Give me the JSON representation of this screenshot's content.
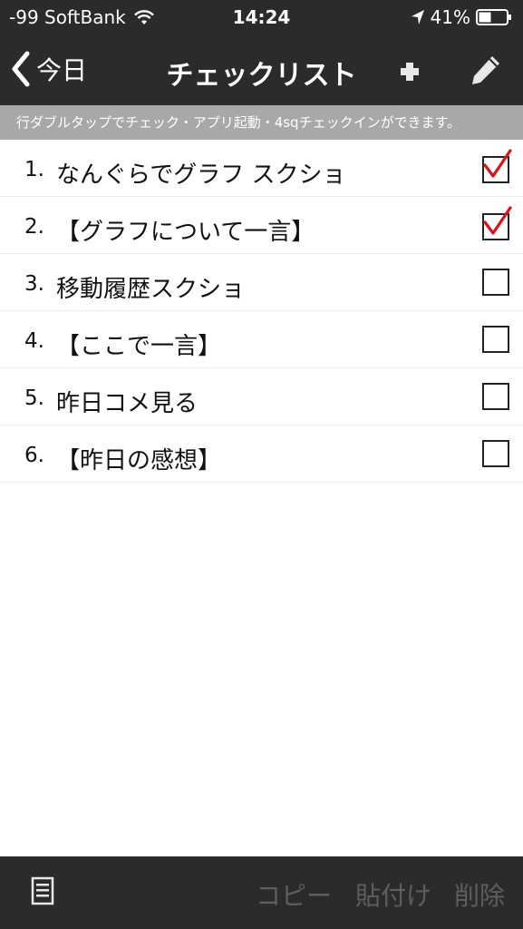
{
  "status": {
    "carrier": "-99 SoftBank",
    "time": "14:24",
    "battery": "41%"
  },
  "nav": {
    "back_label": "今日",
    "title": "チェックリスト"
  },
  "hint": "行ダブルタップでチェック・アプリ起動・4sqチェックインができます。",
  "items": [
    {
      "num": "1.",
      "text": "なんぐらでグラフ スクショ",
      "checked": true
    },
    {
      "num": "2.",
      "text": "【グラフについて一言】",
      "checked": true
    },
    {
      "num": "3.",
      "text": "移動履歴スクショ",
      "checked": false
    },
    {
      "num": "4.",
      "text": "【ここで一言】",
      "checked": false
    },
    {
      "num": "5.",
      "text": "昨日コメ見る",
      "checked": false
    },
    {
      "num": "6.",
      "text": "【昨日の感想】",
      "checked": false
    }
  ],
  "toolbar": {
    "copy_label": "コピー",
    "paste_label": "貼付け",
    "delete_label": "削除"
  },
  "colors": {
    "bar": "#2b2b2b",
    "hint_bg": "#a8a8a8",
    "check_accent": "#e0101a",
    "disabled_text": "#5e5e5e"
  }
}
